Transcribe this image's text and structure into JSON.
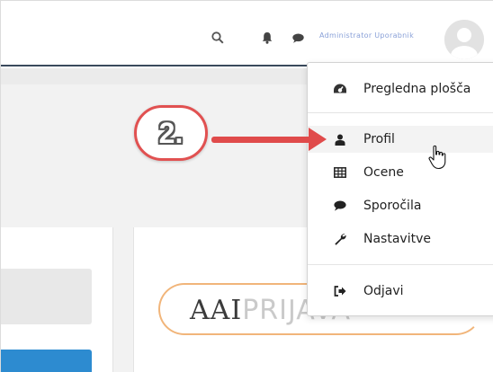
{
  "navbar": {
    "icons": {
      "search": "search-icon",
      "notifications": "bell-icon",
      "messages": "chat-icon"
    },
    "user_name": "Administrator Uporabnik",
    "avatar": "avatar-icon"
  },
  "user_menu": {
    "items": [
      {
        "label": "Pregledna plošča",
        "icon": "dashboard-icon"
      },
      {
        "label": "Profil",
        "icon": "user-icon"
      },
      {
        "label": "Ocene",
        "icon": "table-icon"
      },
      {
        "label": "Sporočila",
        "icon": "chat-icon"
      },
      {
        "label": "Nastavitve",
        "icon": "wrench-icon"
      },
      {
        "label": "Odjavi",
        "icon": "sign-out-icon"
      }
    ]
  },
  "annotation": {
    "step": "2."
  },
  "login": {
    "logo_strong": "AAI",
    "logo_light": "PRIJAVA"
  },
  "colors": {
    "accent": "#e04b4b",
    "nav_border": "#3a4a5c",
    "login_button": "#2d8bd0",
    "dark_tile": "#2f3d4c",
    "logo_arc": "#f1b57a"
  }
}
